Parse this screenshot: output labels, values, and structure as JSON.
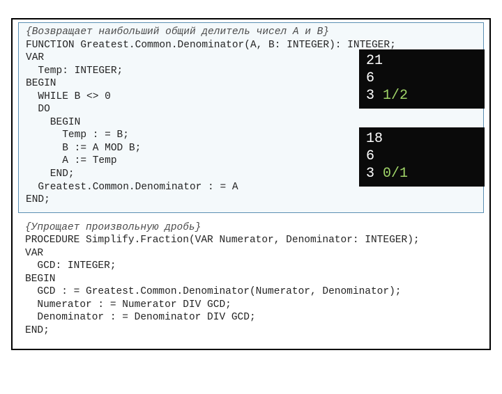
{
  "block1": {
    "comment": "{Возвращает наибольший общий делитель чисел A и B}",
    "lines": [
      "FUNCTION Greatest.Common.Denominator(A, B: INTEGER): INTEGER;",
      "VAR",
      "  Temp: INTEGER;",
      "BEGIN",
      "  WHILE B <> 0",
      "  DO",
      "    BEGIN",
      "      Temp : = B;",
      "      B := A MOD B;",
      "      A := Temp",
      "    END;",
      "  Greatest.Common.Denominator : = A",
      "END;"
    ]
  },
  "console1": {
    "l1": "21",
    "l2": "6",
    "l3_plain": "3 ",
    "l3_green": "1/2"
  },
  "console2": {
    "l1": "18",
    "l2": "6",
    "l3_plain": "3 ",
    "l3_green": "0/1"
  },
  "block2": {
    "comment": "{Упрощает произвольную дробь}",
    "lines": [
      "PROCEDURE Simplify.Fraction(VAR Numerator, Denominator: INTEGER);",
      "VAR",
      "  GCD: INTEGER;",
      "BEGIN",
      "  GCD : = Greatest.Common.Denominator(Numerator, Denominator);",
      "  Numerator : = Numerator DIV GCD;",
      "  Denominator : = Denominator DIV GCD;",
      "END;"
    ]
  }
}
